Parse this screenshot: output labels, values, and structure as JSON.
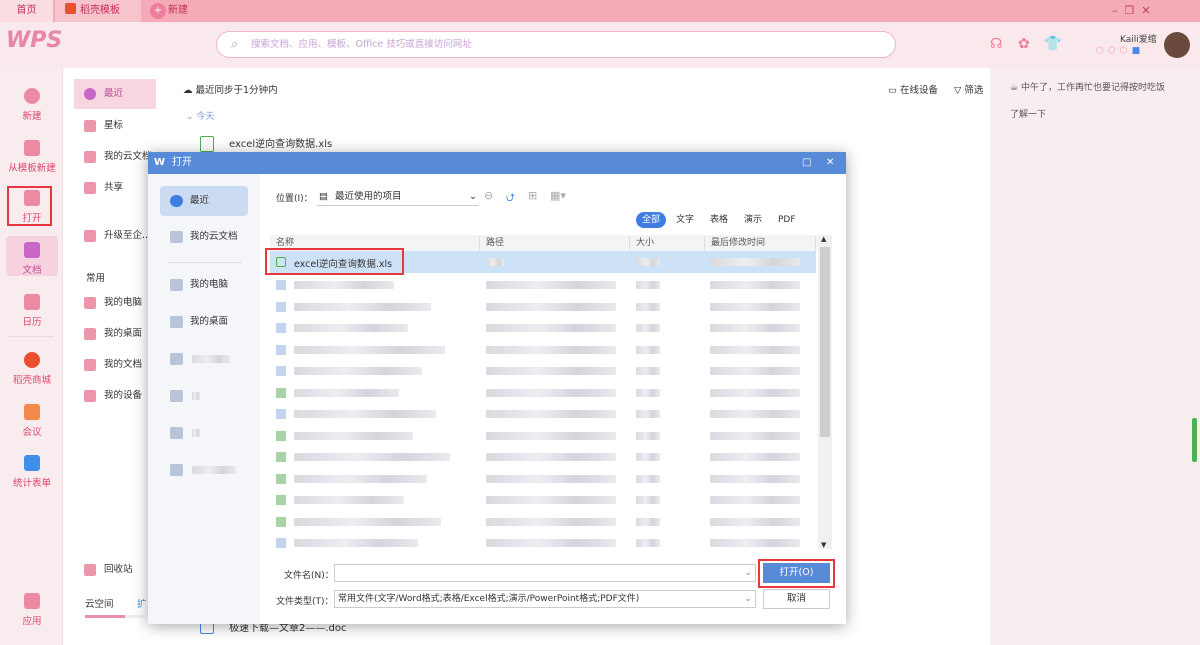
{
  "tabs": [
    {
      "label": "首页"
    },
    {
      "label": "稻壳模板"
    },
    {
      "label": "新建"
    }
  ],
  "header": {
    "logo": "WPS",
    "search_placeholder": "搜索文档、应用、模板、Office 技巧或直接访问网址",
    "user_name": "Kaili爱绾"
  },
  "rail": [
    {
      "label": "新建"
    },
    {
      "label": "从模板新建"
    },
    {
      "label": "打开"
    },
    {
      "label": "文档"
    },
    {
      "label": "日历"
    },
    {
      "label": "稻壳商城"
    },
    {
      "label": "会议"
    },
    {
      "label": "统计表单"
    },
    {
      "label": "应用"
    }
  ],
  "panel2": {
    "items": [
      {
        "label": "最近"
      },
      {
        "label": "星标"
      },
      {
        "label": "我的云文档"
      },
      {
        "label": "共享"
      },
      {
        "label": "升级至企..."
      }
    ],
    "section": "常用",
    "common": [
      {
        "label": "我的电脑"
      },
      {
        "label": "我的桌面"
      },
      {
        "label": "我的文档"
      },
      {
        "label": "我的设备"
      }
    ],
    "trash": "回收站",
    "cloud": "云空间",
    "expand": "扩"
  },
  "main": {
    "sync": "最近同步于1分钟内",
    "online_devices": "在线设备",
    "filter": "筛选",
    "today": "今天",
    "file1": "excel逆向查询数据.xls",
    "file_bottom": "极速下载—文章2——.doc"
  },
  "right": {
    "tip": "中午了，工作再忙也要记得按时吃饭",
    "learn": "了解一下"
  },
  "dialog": {
    "title": "打开",
    "nav": [
      {
        "label": "最近"
      },
      {
        "label": "我的云文档"
      },
      {
        "label": "我的电脑"
      },
      {
        "label": "我的桌面"
      }
    ],
    "location_label": "位置(I)：",
    "location_value": "最近使用的项目",
    "filters": [
      {
        "label": "全部"
      },
      {
        "label": "文字"
      },
      {
        "label": "表格"
      },
      {
        "label": "演示"
      },
      {
        "label": "PDF"
      }
    ],
    "columns": {
      "name": "名称",
      "path": "路径",
      "size": "大小",
      "modified": "最后修改时间"
    },
    "selected_file": "excel逆向查询数据.xls",
    "filename_label": "文件名(N)：",
    "filename_value": "",
    "filetype_label": "文件类型(T)：",
    "filetype_value": "常用文件(文字/Word格式;表格/Excel格式;演示/PowerPoint格式;PDF文件)",
    "open_button": "打开(O)",
    "cancel_button": "取消"
  },
  "colors": {
    "accent_pink": "#e0456f",
    "dialog_blue": "#578ad7",
    "highlight": "#e8383d"
  }
}
